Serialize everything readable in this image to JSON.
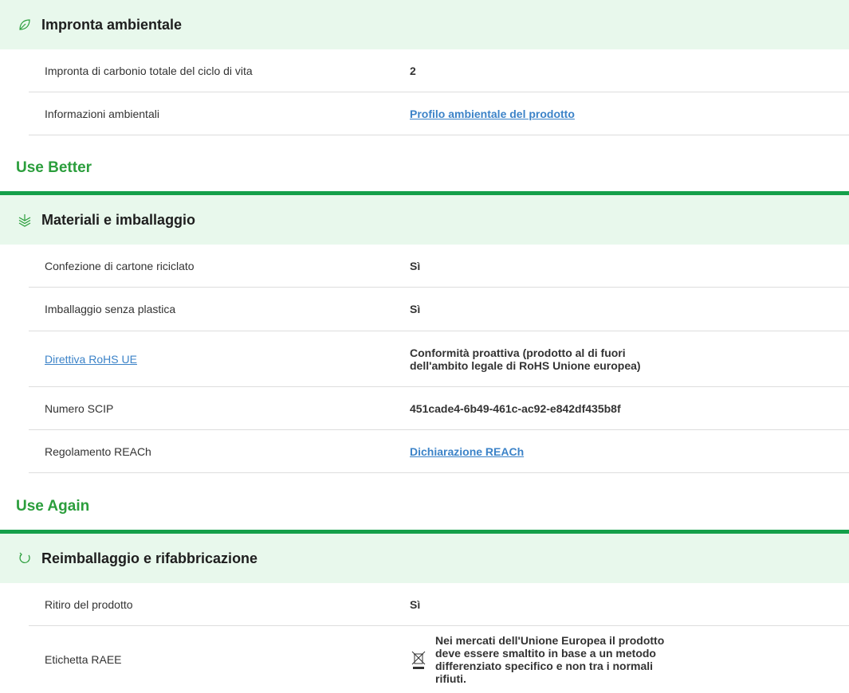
{
  "sections": {
    "footprint": {
      "title": "Impronta ambientale",
      "icon": "leaf-icon",
      "rows": [
        {
          "label": "Impronta di carbonio totale del ciclo di vita",
          "value": "2"
        },
        {
          "label": "Informazioni ambientali",
          "value": "Profilo ambientale del prodotto"
        }
      ]
    },
    "use_better": {
      "heading": "Use Better",
      "panel_title": "Materiali e imballaggio",
      "icon": "layers-icon",
      "rows": [
        {
          "label": "Confezione di cartone riciclato",
          "value": "Sì"
        },
        {
          "label": "Imballaggio senza plastica",
          "value": "Sì"
        },
        {
          "label": "Direttiva RoHS UE",
          "value": "Conformità proattiva (prodotto al di fuori dell'ambito legale di RoHS Unione europea)"
        },
        {
          "label": "Numero SCIP",
          "value": "451cade4-6b49-461c-ac92-e842df435b8f"
        },
        {
          "label": "Regolamento REACh",
          "value": "Dichiarazione REACh"
        }
      ]
    },
    "use_again": {
      "heading": "Use Again",
      "panel_title": "Reimballaggio e rifabbricazione",
      "icon": "recycle-arrow-icon",
      "rows": [
        {
          "label": "Ritiro del prodotto",
          "value": "Sì"
        },
        {
          "label": "Etichetta RAEE",
          "value": "Nei mercati dell'Unione Europea il prodotto deve essere smaltito in base a un metodo differenziato specifico e non tra i normali rifiuti."
        }
      ]
    }
  },
  "colors": {
    "panel_bg": "#e8f8ec",
    "accent_green": "#14a04a",
    "heading_green": "#2b9e3c",
    "link_blue": "#3c83c8"
  }
}
